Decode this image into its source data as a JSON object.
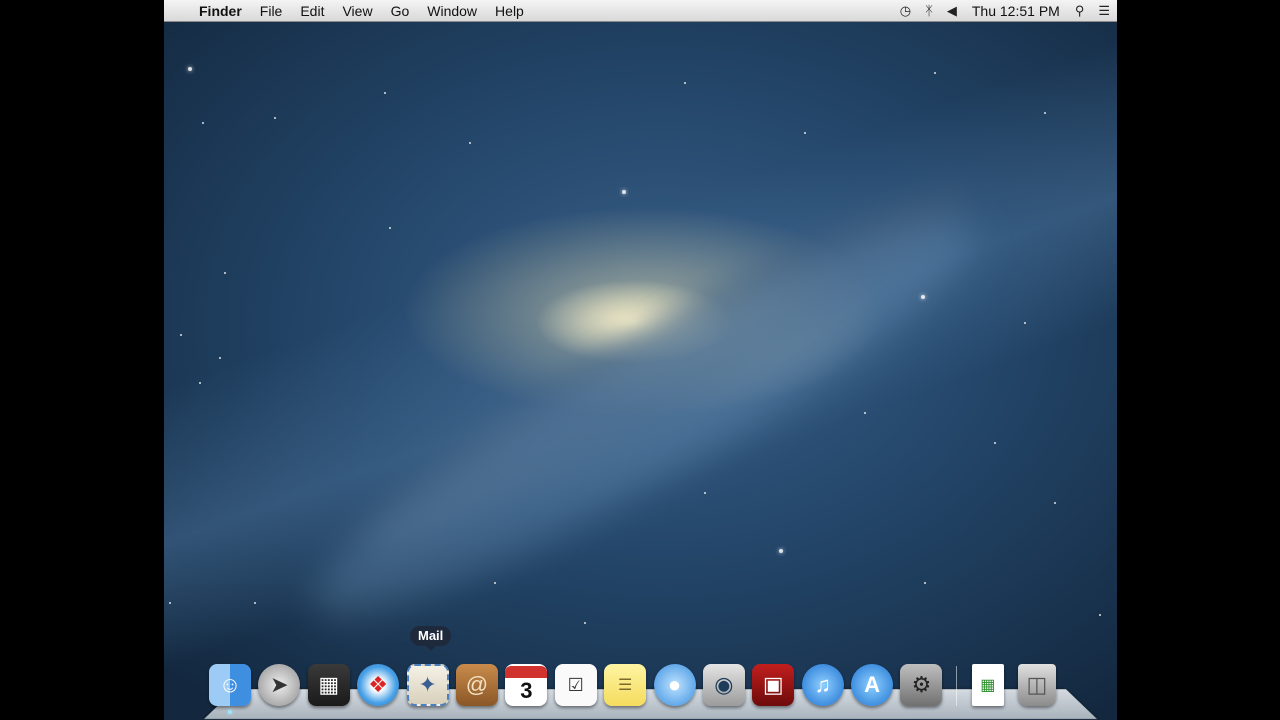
{
  "menubar": {
    "apple_icon": "",
    "app_name": "Finder",
    "menus": [
      "File",
      "Edit",
      "View",
      "Go",
      "Window",
      "Help"
    ],
    "clock": "Thu 12:51 PM",
    "status_icons": [
      "time-machine-icon",
      "bluetooth-icon",
      "volume-icon",
      "spotlight-icon",
      "notification-center-icon"
    ]
  },
  "dock": {
    "tooltip": "Mail",
    "apps": [
      "Finder",
      "Launchpad",
      "Mission Control",
      "Safari",
      "Mail",
      "Contacts",
      "Calendar",
      "Reminders",
      "Notes",
      "Messages",
      "FaceTime",
      "Photo Booth",
      "iTunes",
      "App Store",
      "System Preferences"
    ],
    "calendar_day": "3",
    "others": [
      "Document",
      "Trash"
    ]
  }
}
